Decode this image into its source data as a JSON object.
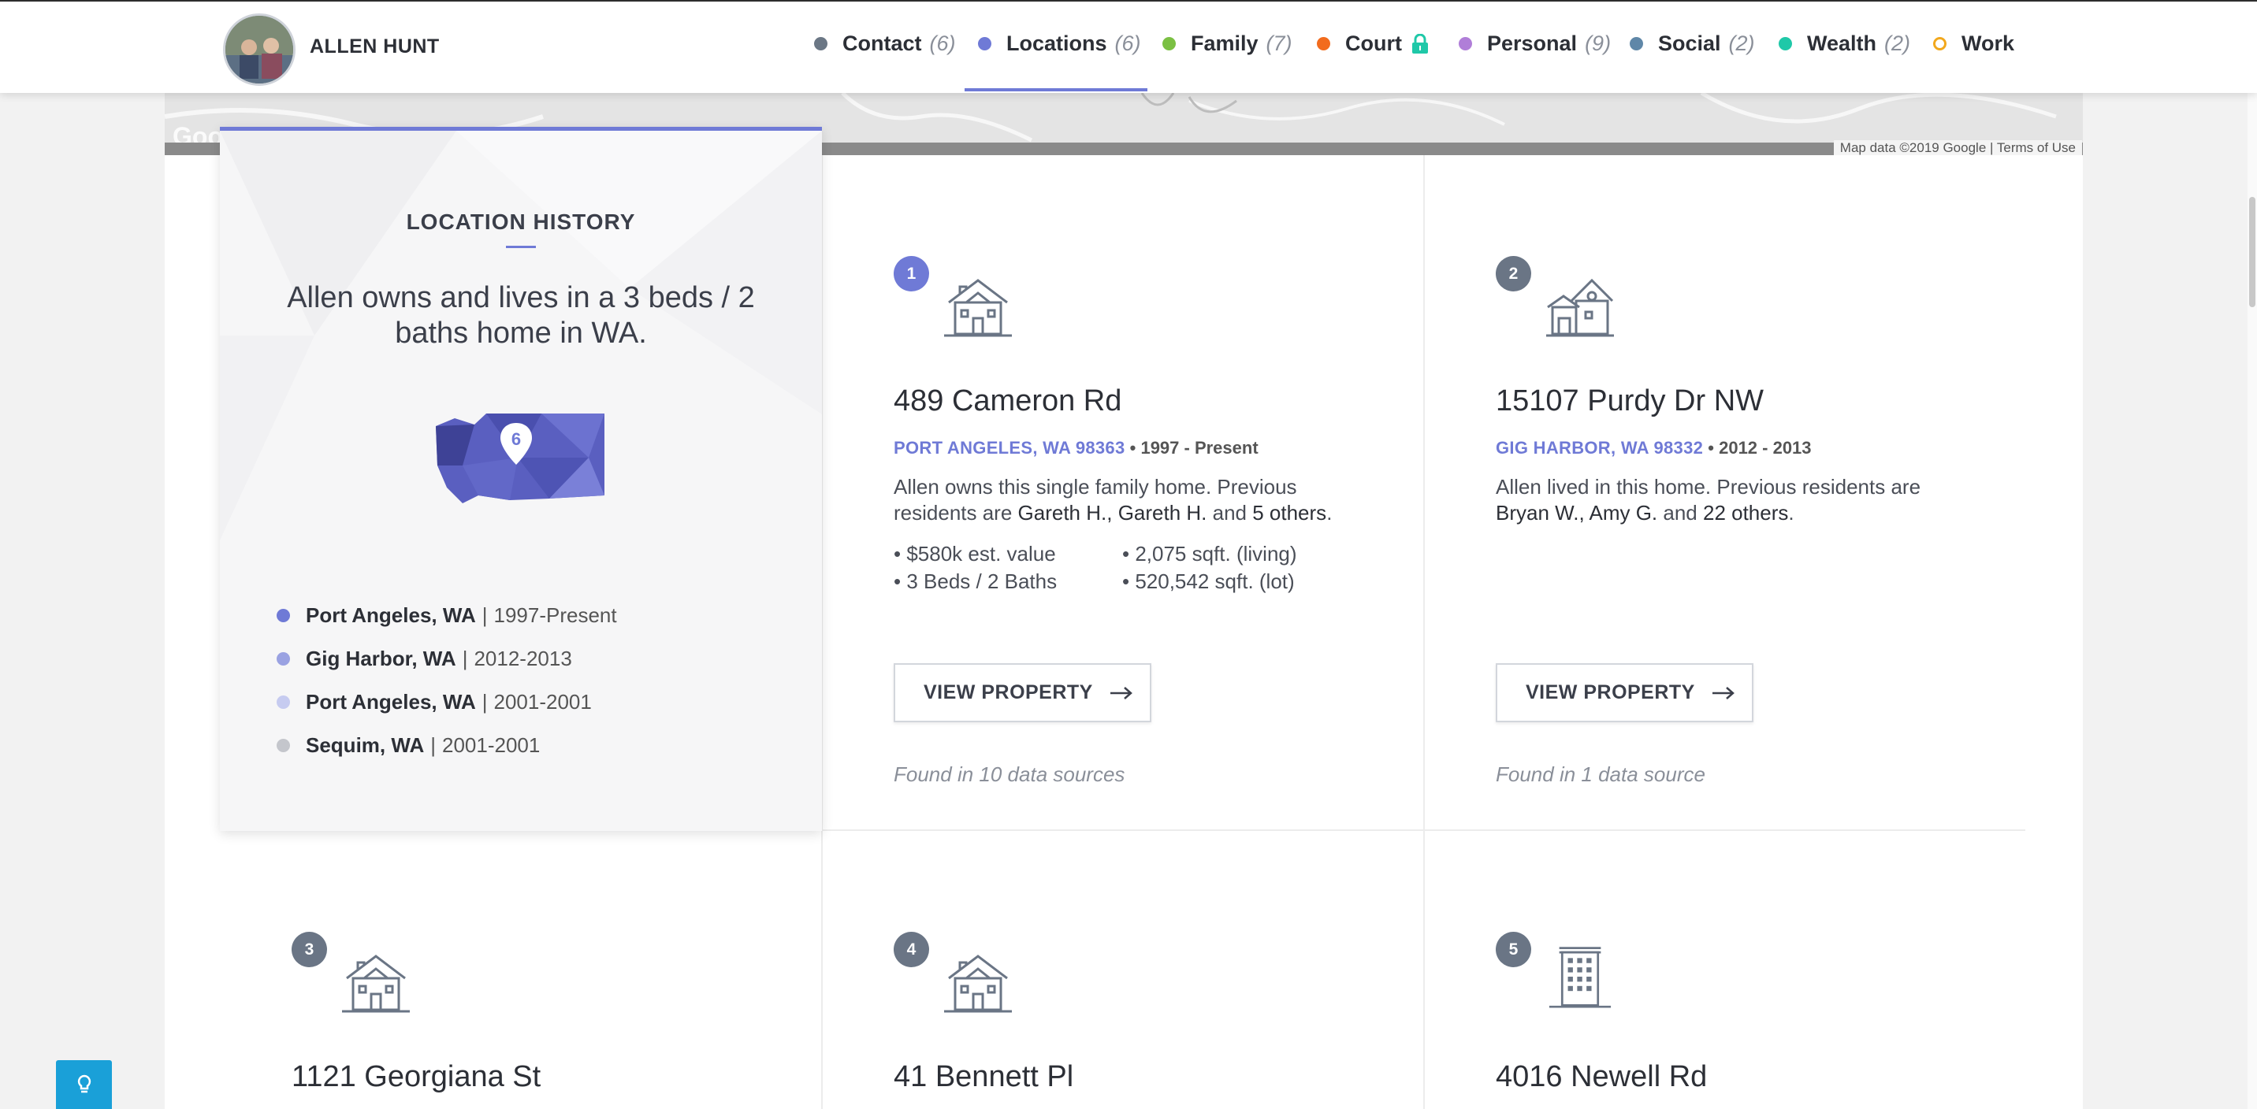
{
  "header": {
    "name": "ALLEN HUNT",
    "nav": [
      {
        "label": "Contact",
        "count": "(6)",
        "color": "#6b7785"
      },
      {
        "label": "Locations",
        "count": "(6)",
        "color": "#6f7ad6"
      },
      {
        "label": "Family",
        "count": "(7)",
        "color": "#7bc043"
      },
      {
        "label": "Court",
        "count": "",
        "color": "#f26b1d",
        "locked": true
      },
      {
        "label": "Personal",
        "count": "(9)",
        "color": "#b07ed8"
      },
      {
        "label": "Social",
        "count": "(2)",
        "color": "#5f87a8"
      },
      {
        "label": "Wealth",
        "count": "(2)",
        "color": "#1fc8a8"
      },
      {
        "label": "Work",
        "count": "",
        "color": "#f2a81d",
        "hollow": true
      }
    ],
    "active_tab": "Locations"
  },
  "map": {
    "credit": "Map data ©2019 Google",
    "terms": "Terms of Use",
    "logo": "Goo"
  },
  "history": {
    "title": "LOCATION HISTORY",
    "summary": "Allen owns and lives in a 3 beds / 2 baths home in WA.",
    "map_count": "6",
    "items": [
      {
        "place": "Port Angeles, WA",
        "years": "1997-Present",
        "color": "#6f7ad6"
      },
      {
        "place": "Gig Harbor, WA",
        "years": "2012-2013",
        "color": "#9aa2e2"
      },
      {
        "place": "Port Angeles, WA",
        "years": "2001-2001",
        "color": "#c6cbf0"
      },
      {
        "place": "Sequim, WA",
        "years": "2001-2001",
        "color": "#c4c6cc"
      }
    ]
  },
  "properties": [
    {
      "number": "1",
      "address": "489 Cameron Rd",
      "city": "PORT ANGELES, WA 98363",
      "years": "1997 - Present",
      "desc_pre": "Allen owns this single family home. Previous residents are ",
      "desc_names": "Gareth H., Gareth H.",
      "desc_and": " and ",
      "desc_others": "5 others",
      "facts": [
        "$580k est. value",
        "3 Beds / 2 Baths",
        "2,075 sqft. (living)",
        "520,542 sqft. (lot)"
      ],
      "button": "VIEW PROPERTY",
      "found": "Found in 10 data sources"
    },
    {
      "number": "2",
      "address": "15107 Purdy Dr NW",
      "city": "GIG HARBOR, WA 98332",
      "years": "2012 - 2013",
      "desc_pre": "Allen lived in this home. Previous residents are ",
      "desc_names": "Bryan W., Amy G.",
      "desc_and": " and ",
      "desc_others": "22 others",
      "button": "VIEW PROPERTY",
      "found": "Found in 1 data source"
    },
    {
      "number": "3",
      "address": "1121 Georgiana St"
    },
    {
      "number": "4",
      "address": "41 Bennett Pl"
    },
    {
      "number": "5",
      "address": "4016 Newell Rd"
    }
  ],
  "icons": {
    "house": "house-icon",
    "building": "apartment-building-icon",
    "lock": "lock-icon",
    "arrow": "arrow-right-icon",
    "tip": "lightbulb-icon"
  }
}
